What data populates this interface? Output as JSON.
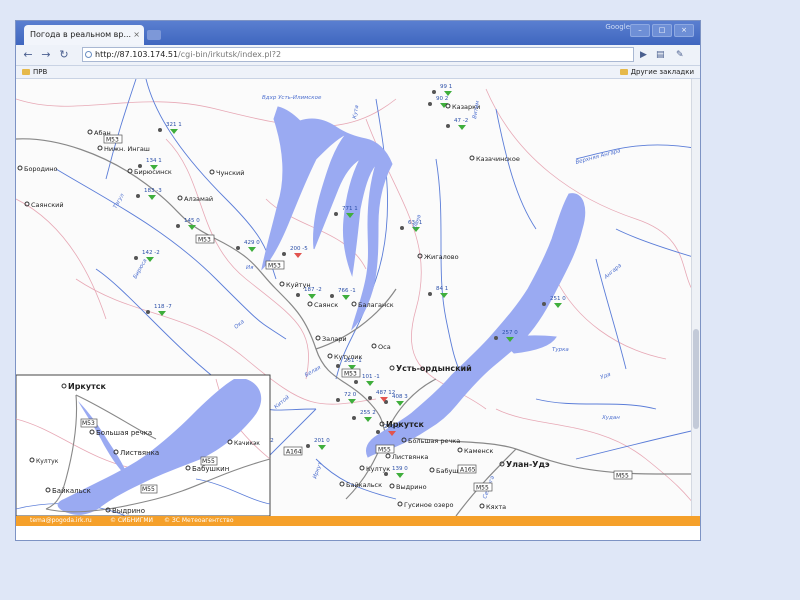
{
  "browser": {
    "tab_title": "Погода в реальном вр...",
    "tab_close": "×",
    "brand": "Google",
    "url_host": "http://87.103.174.51",
    "url_path": "/cgi-bin/irkutsk/index.pl?2",
    "bookmarks_left": "ПРВ",
    "bookmarks_right": "Другие закладки"
  },
  "map": {
    "cities": [
      {
        "name": "Абан"
      },
      {
        "name": "Нижн. Ингаш"
      },
      {
        "name": "Бородино"
      },
      {
        "name": "Бирюсинск"
      },
      {
        "name": "Чунский"
      },
      {
        "name": "Саянский"
      },
      {
        "name": "Алзамай"
      },
      {
        "name": "Казарки"
      },
      {
        "name": "Казачинское"
      },
      {
        "name": "Жигалово"
      },
      {
        "name": "Куйтун"
      },
      {
        "name": "Саянск"
      },
      {
        "name": "Залари"
      },
      {
        "name": "Кутулик"
      },
      {
        "name": "Оса"
      },
      {
        "name": "Усть-ордынский"
      },
      {
        "name": "Иркутск"
      },
      {
        "name": "Большая речка"
      },
      {
        "name": "Листвянка"
      },
      {
        "name": "Каменск"
      },
      {
        "name": "Улан-Удэ"
      },
      {
        "name": "Бабушкин"
      },
      {
        "name": "Байкальск"
      },
      {
        "name": "Выдрино"
      },
      {
        "name": "Гусиное озеро"
      },
      {
        "name": "Селенгинск"
      },
      {
        "name": "Балаганск"
      },
      {
        "name": "Култук"
      },
      {
        "name": "Кяхта"
      }
    ],
    "water_labels": [
      "Вдхр Усть-Илимское",
      "Кута",
      "Лена",
      "Верхняя Ангара",
      "Ангара",
      "Витим",
      "Турка",
      "Уда",
      "Худан",
      "Селенга",
      "Ока",
      "Белая",
      "Китой",
      "Иркут",
      "Ия",
      "Бирюса",
      "Тагул"
    ],
    "readings": [
      "321 1",
      "134 1",
      "183 -3",
      "145 0",
      "429 0",
      "200 -5",
      "142 -2",
      "118 -7",
      "187 -2",
      "766 -1",
      "771 1",
      "63 -1",
      "84 1",
      "90 2",
      "99 1",
      "47 -2",
      "251 0",
      "257 0",
      "251 -1",
      "72 0",
      "101 -1",
      "255 2",
      "408 3",
      "487 12",
      "255 1",
      "201 0",
      "242 -2",
      "139 0"
    ],
    "roads": [
      "M53",
      "M53",
      "M53",
      "M53",
      "M55",
      "M55",
      "A164",
      "A165",
      "M55"
    ],
    "inset_labels": [
      "Иркутск",
      "Большая речка",
      "Листвянка",
      "Бабушкин",
      "Байкальск",
      "Выдрино",
      "Култук",
      "Качикэк",
      "M53",
      "M55",
      "M55"
    ]
  },
  "footer": {
    "email": "tema@pogoda.irk.ru",
    "org1": "© СИБНИГМИ",
    "org2": "© ЗС Метеоагентство"
  },
  "colors": {
    "water": "#9aaaf2",
    "river": "#5b7dd8",
    "road": "#888888",
    "border": "#e7a8b5",
    "footer": "#f5a02a"
  }
}
